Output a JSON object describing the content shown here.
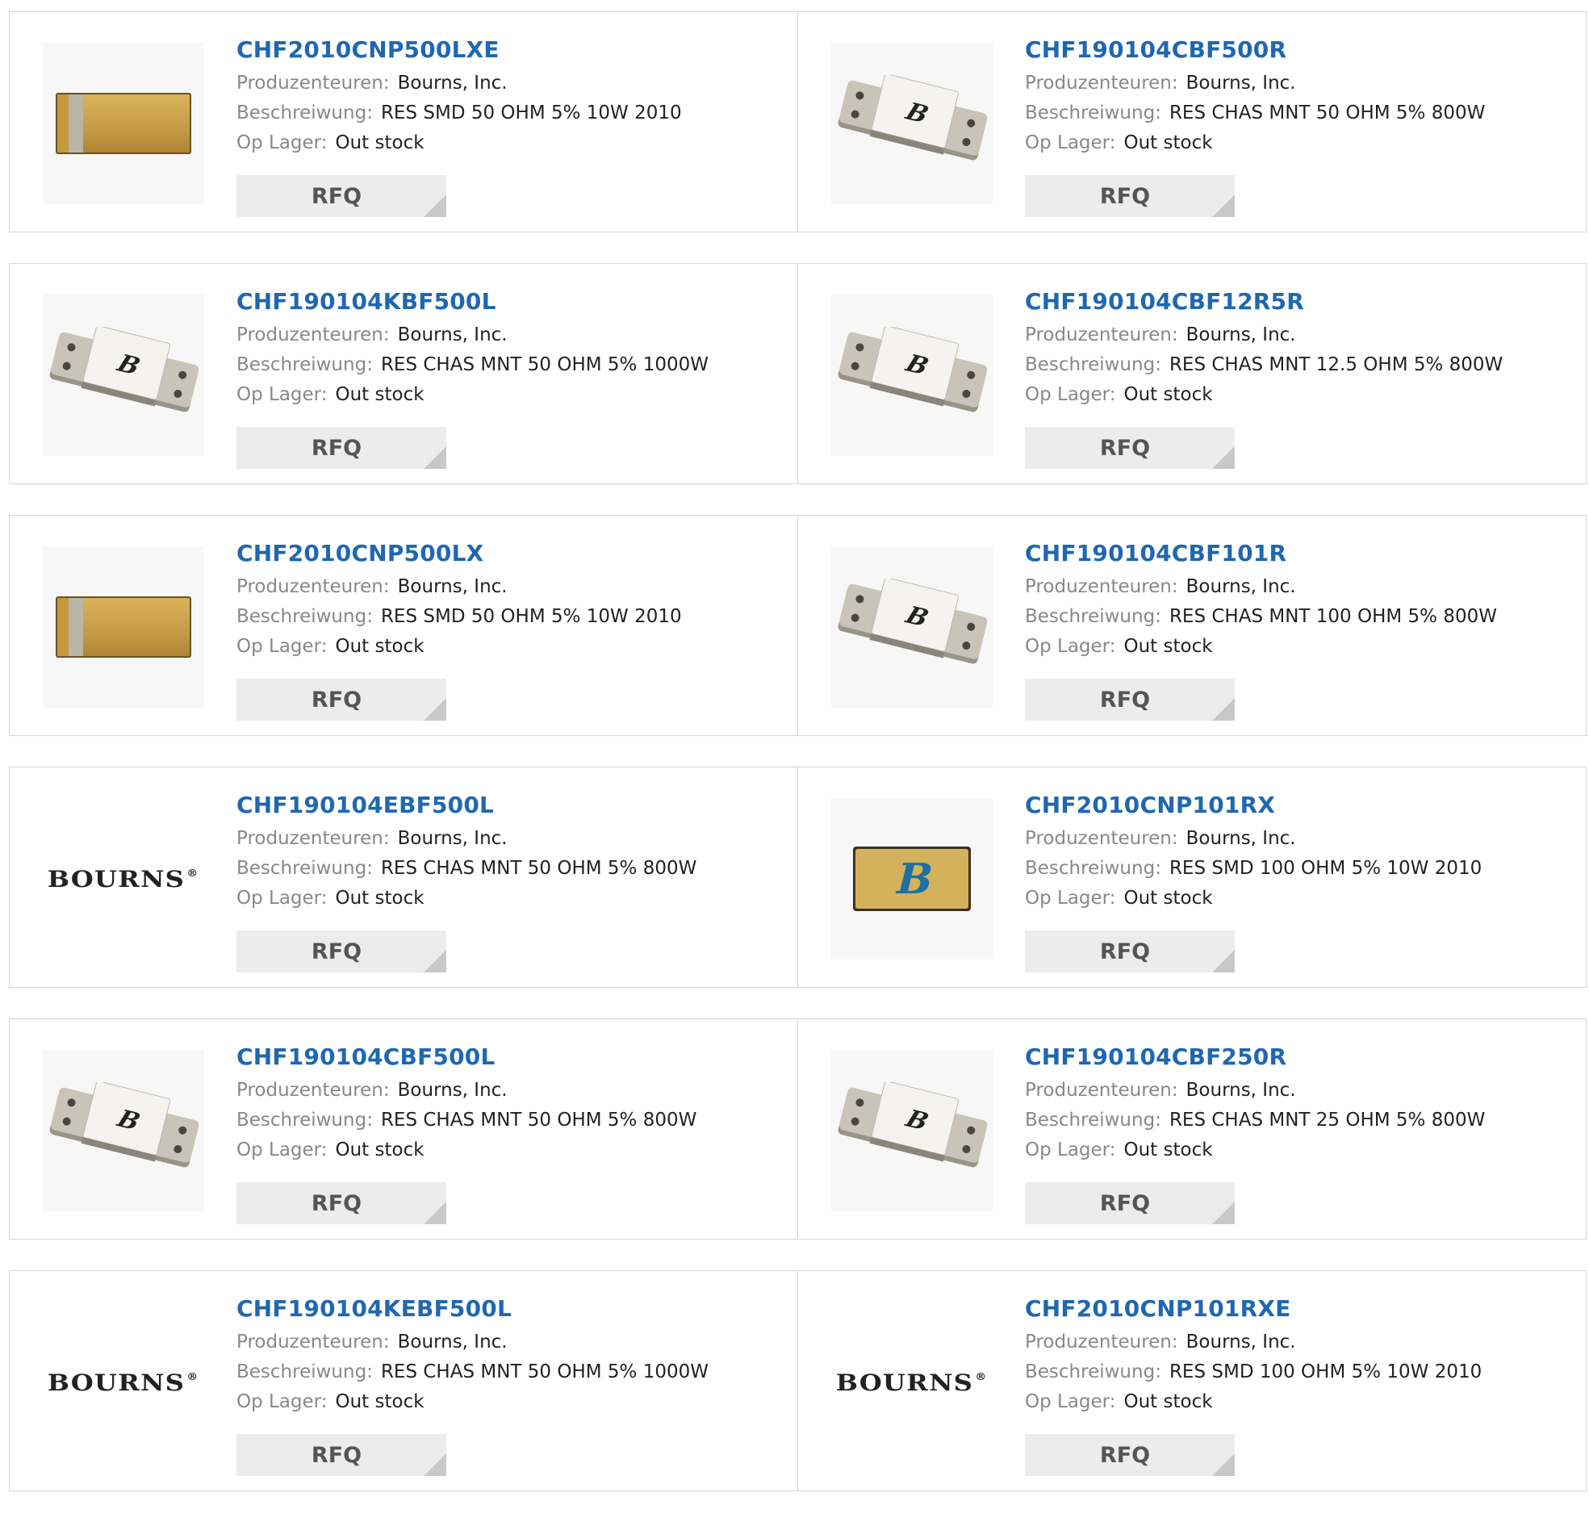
{
  "labels": {
    "manufacturer": "Produzenteuren:",
    "description": "Beschreiwung:",
    "stock": "Op Lager:",
    "rfq": "RFQ"
  },
  "colors": {
    "part_number": "#1f67b1",
    "label": "#888888",
    "value": "#222222",
    "rfq_bg": "#ececec",
    "border": "#d5d5d5"
  },
  "products": [
    {
      "part_number": "CHF2010CNP500LXE",
      "manufacturer": "Bourns, Inc.",
      "description": "RES SMD 50 OHM 5% 10W 2010",
      "stock": "Out stock",
      "image": "smd-chip-resistor-icon"
    },
    {
      "part_number": "CHF190104CBF500R",
      "manufacturer": "Bourns, Inc.",
      "description": "RES CHAS MNT 50 OHM 5% 800W",
      "stock": "Out stock",
      "image": "chassis-mount-resistor-icon"
    },
    {
      "part_number": "CHF190104KBF500L",
      "manufacturer": "Bourns, Inc.",
      "description": "RES CHAS MNT 50 OHM 5% 1000W",
      "stock": "Out stock",
      "image": "chassis-mount-resistor-icon"
    },
    {
      "part_number": "CHF190104CBF12R5R",
      "manufacturer": "Bourns, Inc.",
      "description": "RES CHAS MNT 12.5 OHM 5% 800W",
      "stock": "Out stock",
      "image": "chassis-mount-resistor-icon"
    },
    {
      "part_number": "CHF2010CNP500LX",
      "manufacturer": "Bourns, Inc.",
      "description": "RES SMD 50 OHM 5% 10W 2010",
      "stock": "Out stock",
      "image": "smd-chip-resistor-icon"
    },
    {
      "part_number": "CHF190104CBF101R",
      "manufacturer": "Bourns, Inc.",
      "description": "RES CHAS MNT 100 OHM 5% 800W",
      "stock": "Out stock",
      "image": "chassis-mount-resistor-icon"
    },
    {
      "part_number": "CHF190104EBF500L",
      "manufacturer": "Bourns, Inc.",
      "description": "RES CHAS MNT 50 OHM 5% 800W",
      "stock": "Out stock",
      "image": "bourns-logo"
    },
    {
      "part_number": "CHF2010CNP101RX",
      "manufacturer": "Bourns, Inc.",
      "description": "RES SMD 100 OHM 5% 10W 2010",
      "stock": "Out stock",
      "image": "smd-chip-blue-logo-icon"
    },
    {
      "part_number": "CHF190104CBF500L",
      "manufacturer": "Bourns, Inc.",
      "description": "RES CHAS MNT 50 OHM 5% 800W",
      "stock": "Out stock",
      "image": "chassis-mount-resistor-icon"
    },
    {
      "part_number": "CHF190104CBF250R",
      "manufacturer": "Bourns, Inc.",
      "description": "RES CHAS MNT 25 OHM 5% 800W",
      "stock": "Out stock",
      "image": "chassis-mount-resistor-icon"
    },
    {
      "part_number": "CHF190104KEBF500L",
      "manufacturer": "Bourns, Inc.",
      "description": "RES CHAS MNT 50 OHM 5% 1000W",
      "stock": "Out stock",
      "image": "bourns-logo"
    },
    {
      "part_number": "CHF2010CNP101RXE",
      "manufacturer": "Bourns, Inc.",
      "description": "RES SMD 100 OHM 5% 10W 2010",
      "stock": "Out stock",
      "image": "bourns-logo"
    }
  ],
  "brand_logo_text": "BOURNS",
  "brand_logo_mark": "®"
}
